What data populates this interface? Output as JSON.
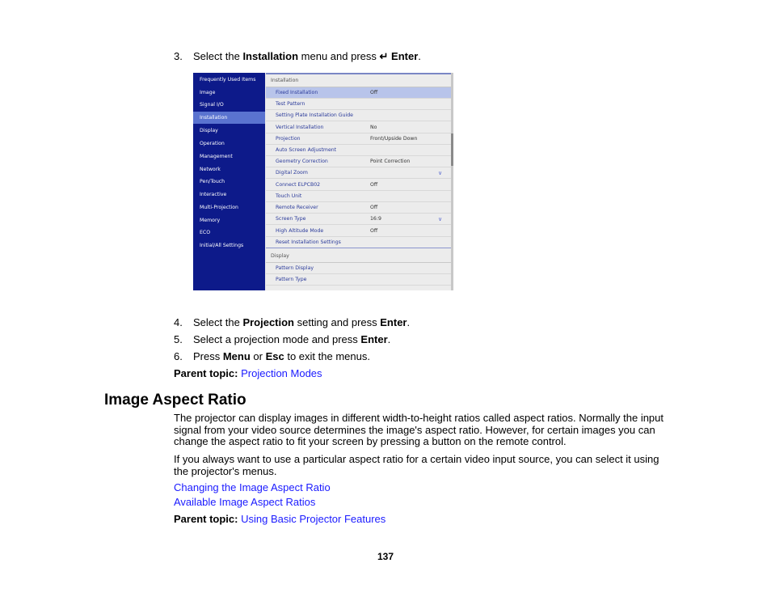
{
  "steps": {
    "s3": {
      "num": "3.",
      "pre": "Select the ",
      "bold1": "Installation",
      "mid": " menu and press ",
      "icon": "enter-icon",
      "bold2": "Enter",
      "post": "."
    },
    "s4": {
      "num": "4.",
      "pre": "Select the ",
      "bold1": "Projection",
      "mid": " setting and press ",
      "bold2": "Enter",
      "post": "."
    },
    "s5": {
      "num": "5.",
      "pre": "Select a projection mode and press ",
      "bold1": "Enter",
      "post": "."
    },
    "s6": {
      "num": "6.",
      "pre": "Press ",
      "bold1": "Menu",
      "mid": " or ",
      "bold2": "Esc",
      "post": " to exit the menus."
    }
  },
  "menu_screenshot": {
    "sidebar": [
      "Frequently Used Items",
      "Image",
      "Signal I/O",
      "Installation",
      "Display",
      "Operation",
      "Management",
      "Network",
      "Pen/Touch",
      "Interactive",
      "Multi-Projection",
      "Memory",
      "ECO",
      "Initial/All Settings"
    ],
    "sidebar_active": "Installation",
    "panel_header": "Installation",
    "rows": [
      {
        "label": "Fixed Installation",
        "value": "Off"
      },
      {
        "label": "Test Pattern",
        "value": ""
      },
      {
        "label": "Setting Plate Installation Guide",
        "value": ""
      },
      {
        "label": "Vertical Installation",
        "value": "No"
      },
      {
        "label": "Projection",
        "value": "Front/Upside Down"
      },
      {
        "label": "Auto Screen Adjustment",
        "value": ""
      },
      {
        "label": "Geometry Correction",
        "value": "Point Correction"
      },
      {
        "label": "Digital Zoom",
        "value": ""
      },
      {
        "label": "Connect ELPCB02",
        "value": "Off"
      },
      {
        "label": "Touch Unit",
        "value": ""
      },
      {
        "label": "Remote Receiver",
        "value": "Off"
      },
      {
        "label": "Screen Type",
        "value": "16:9"
      },
      {
        "label": "High Altitude Mode",
        "value": "Off"
      },
      {
        "label": "Reset Installation Settings",
        "value": ""
      }
    ],
    "selected_row": "Fixed Installation",
    "section2_header": "Display",
    "section2_rows": [
      {
        "label": "Pattern Display",
        "value": ""
      },
      {
        "label": "Pattern Type",
        "value": ""
      }
    ]
  },
  "parent_topic_1": {
    "label": "Parent topic:",
    "link": "Projection Modes"
  },
  "section": {
    "title": "Image Aspect Ratio",
    "para1": "The projector can display images in different width-to-height ratios called aspect ratios. Normally the input signal from your video source determines the image's aspect ratio. However, for certain images you can change the aspect ratio to fit your screen by pressing a button on the remote control.",
    "para2": "If you always want to use a particular aspect ratio for a certain video input source, you can select it using the projector's menus.",
    "links": [
      "Changing the Image Aspect Ratio",
      "Available Image Aspect Ratios"
    ],
    "parent_topic": {
      "label": "Parent topic:",
      "link": "Using Basic Projector Features"
    }
  },
  "page_number": "137"
}
